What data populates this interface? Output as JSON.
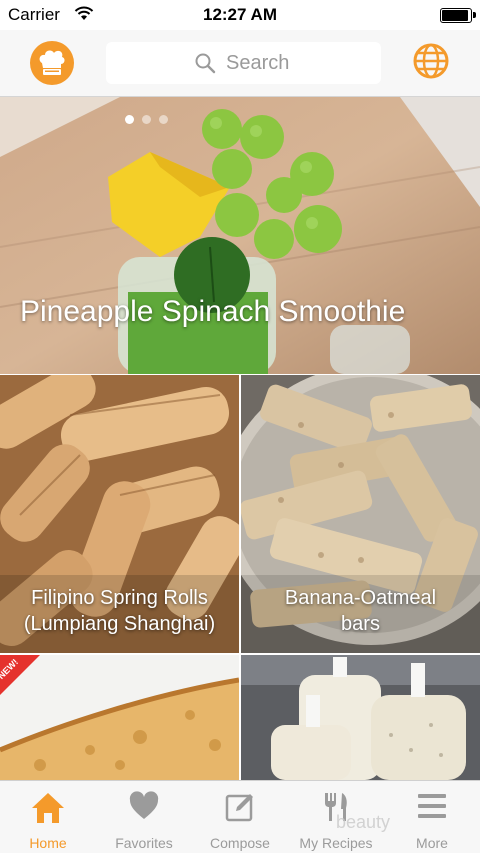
{
  "status_bar": {
    "carrier": "Carrier",
    "time": "12:27 AM",
    "battery_level": 1.0
  },
  "navbar": {
    "search_placeholder": "Search",
    "left_icon": "chef-hat-icon",
    "right_icon": "globe-icon"
  },
  "hero": {
    "title": "Pineapple Spinach Smoothie",
    "page_count": 3,
    "active_page": 1
  },
  "recipes": [
    {
      "title_line1": "Filipino Spring Rolls",
      "title_line2": "(Lumpiang Shanghai)"
    },
    {
      "title_line1": "Banana-Oatmeal",
      "title_line2": "bars"
    },
    {
      "badge": "NEW!"
    }
  ],
  "tabs": [
    {
      "label": "Home",
      "icon": "home-icon",
      "active": true
    },
    {
      "label": "Favorites",
      "icon": "heart-icon",
      "active": false
    },
    {
      "label": "Compose",
      "icon": "compose-icon",
      "active": false
    },
    {
      "label": "My Recipes",
      "icon": "fork-knife-icon",
      "active": false
    },
    {
      "label": "More",
      "icon": "menu-icon",
      "active": false
    }
  ],
  "watermark": "beauty",
  "colors": {
    "accent": "#f49a2b",
    "inactive": "#9b9b9b"
  }
}
